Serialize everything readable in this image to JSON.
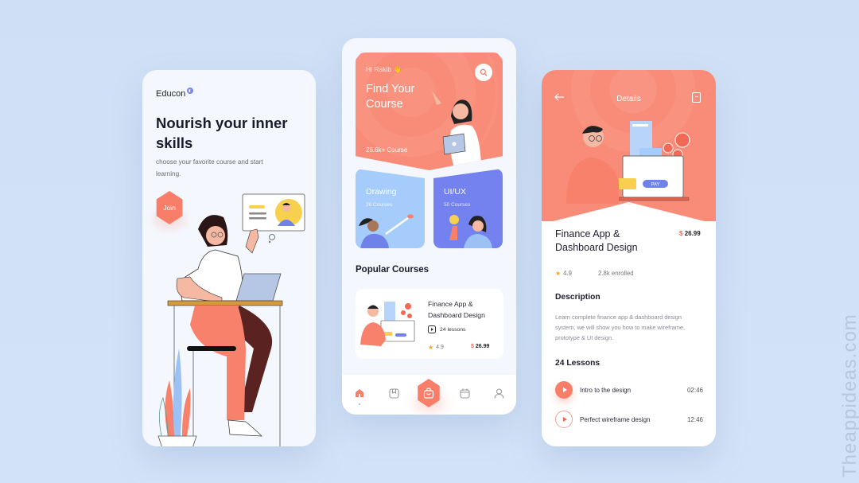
{
  "colors": {
    "background": "#cfe0f6",
    "accent": "#f87e69",
    "drawing_card": "#a6ccfb",
    "uiux_card": "#7382ee",
    "price_symbol": "#f26a55",
    "star": "#f5a623"
  },
  "onboarding": {
    "brand": "Educon",
    "title": "Nourish your inner skills",
    "subtitle": "choose your favorite course and start learning.",
    "join_label": "Join",
    "illustration": "woman-at-laptop-video-call"
  },
  "home": {
    "greeting": "Hi Rakib 👋",
    "hero_title": "Find Your Course",
    "course_count": "25.6k+ Course",
    "search_icon": "search-icon",
    "categories": [
      {
        "title": "Drawing",
        "count": "26 Courses"
      },
      {
        "title": "UI/UX",
        "count": "50 Courses"
      }
    ],
    "popular_title": "Popular Courses",
    "popular_course": {
      "title": "Finance App & Dashboard Design",
      "lessons": "24 lessons",
      "rating": "4.9",
      "currency": "$",
      "price": "26.99"
    },
    "nav": [
      {
        "icon": "home-icon",
        "active": true
      },
      {
        "icon": "bookmark-icon",
        "active": false
      },
      {
        "icon": "bag-icon",
        "active": false
      },
      {
        "icon": "calendar-icon",
        "active": false
      },
      {
        "icon": "profile-icon",
        "active": false
      }
    ]
  },
  "details": {
    "header_title": "Details",
    "back_icon": "arrow-left-icon",
    "bookmark_icon": "bookmark-icon",
    "illustration_pay_label": "PAY",
    "course_title": "Finance App & Dashboard Design",
    "currency": "$",
    "price": "26.99",
    "rating": "4.9",
    "enrolled": "2.8k enrolled",
    "description_heading": "Description",
    "description": "Learn complete finance app & dashboard design system, we will show you how to make wireframe, prototype & UI design.",
    "lessons_heading": "24 Lessons",
    "lessons": [
      {
        "name": "Intro to the design",
        "duration": "02:46",
        "state": "playing"
      },
      {
        "name": "Perfect wireframe design",
        "duration": "12:46",
        "state": "idle"
      }
    ]
  },
  "watermark": "Theappideas.com"
}
